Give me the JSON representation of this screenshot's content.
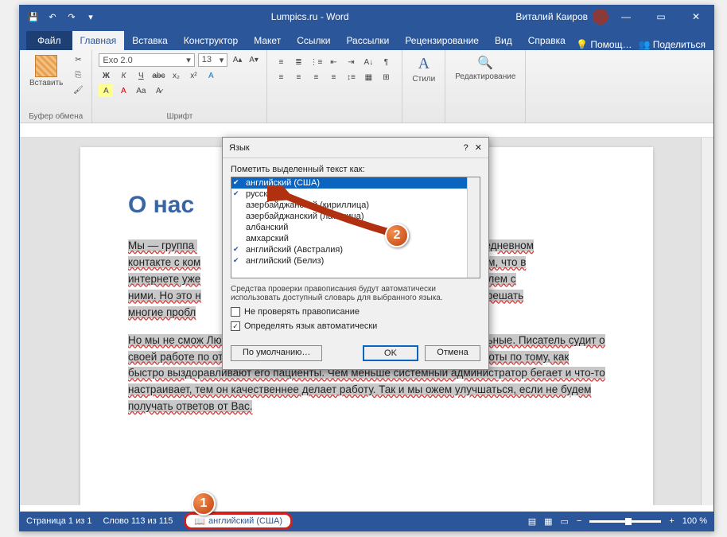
{
  "titlebar": {
    "title": "Lumpics.ru - Word",
    "user": "Виталий Каиров"
  },
  "tabs": {
    "file": "Файл",
    "items": [
      "Главная",
      "Вставка",
      "Конструктор",
      "Макет",
      "Ссылки",
      "Рассылки",
      "Рецензирование",
      "Вид",
      "Справка"
    ],
    "active_index": 0,
    "help": "Помощ…",
    "share": "Поделиться"
  },
  "ribbon": {
    "paste": "Вставить",
    "clipboard_label": "Буфер обмена",
    "font_name": "Exo 2.0",
    "font_size": "13",
    "font_label": "Шрифт",
    "styles": "Стили",
    "editing": "Редактирование"
  },
  "document": {
    "heading": "О нас",
    "p1_left": "Мы — группа ",
    "p1_right": "ам в ежедневном ",
    "p2": "контакте с ком",
    "p2b": "Мы знаем, что в ",
    "p3": "интернете уже",
    "p3b": "да проблем с ",
    "p4": "ними. Но это н",
    "p4b": "Вам, как решать ",
    "p5": "многие пробл",
    "para2": "Но мы не смож                                                                                                   Любому человеку важно знать, что его действия правильные. Писатель судит о своей работе по отзывам читателей. Доктор судит о качестве своей работы по тому, как быстро выздоравливают его пациенты. Чем меньше системный администратор бегает и что-то настраивает, тем он качественнее делает работу. Так и мы           ожем улучшаться, если не будем получать ответов от Вас."
  },
  "dialog": {
    "title": "Язык",
    "label": "Пометить выделенный текст как:",
    "items": [
      "английский (США)",
      "русский",
      "азербайджанский (кириллица)",
      "азербайджанский (латиница)",
      "албанский",
      "амхарский",
      "английский (Австралия)",
      "английский (Белиз)"
    ],
    "selected_index": 0,
    "info": "Средства проверки правописания будут автоматически использовать доступный словарь для выбранного языка.",
    "chk1": "Не проверять правописание",
    "chk2": "Определять язык автоматически",
    "default_btn": "По умолчанию…",
    "ok": "OK",
    "cancel": "Отмена"
  },
  "statusbar": {
    "page": "Страница 1 из 1",
    "words": "Слово 113 из 115",
    "lang": "английский (США)",
    "zoom": "100 %"
  },
  "callouts": {
    "one": "1",
    "two": "2"
  }
}
